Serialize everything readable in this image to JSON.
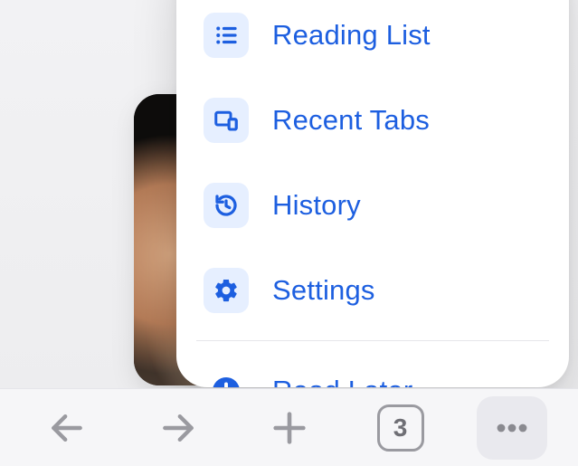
{
  "menu": {
    "reading_list": "Reading List",
    "recent_tabs": "Recent Tabs",
    "history": "History",
    "settings": "Settings",
    "read_later": "Read Later"
  },
  "toolbar": {
    "tab_count": "3"
  },
  "colors": {
    "accent": "#1d5fe0",
    "icon_bg": "#e6efff",
    "toolbar_bg": "#f6f6f8",
    "toolbar_icon": "#9a9aa0"
  }
}
